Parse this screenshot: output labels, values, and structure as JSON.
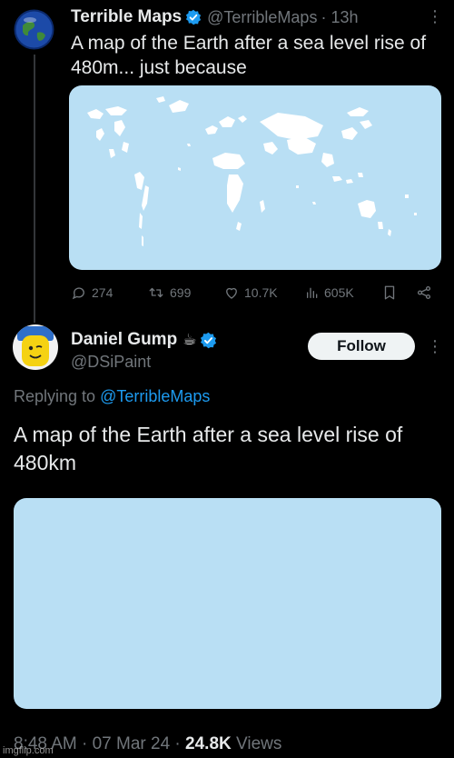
{
  "tweet1": {
    "display_name": "Terrible Maps",
    "handle": "@TerribleMaps",
    "time": "· 13h",
    "more": "⋮",
    "text": "A map of the Earth after a sea level rise of 480m... just because",
    "stats": {
      "replies": "274",
      "retweets": "699",
      "likes": "10.7K",
      "views": "605K"
    }
  },
  "tweet2": {
    "display_name": "Daniel Gump",
    "name_emoji": "☕",
    "handle": "@DSiPaint",
    "follow_label": "Follow",
    "more": "⋮",
    "replying_prefix": "Replying to",
    "replying_handle": "@TerribleMaps",
    "text": "A map of the Earth after a sea level rise of 480km",
    "meta_time": "8:48 AM · 07 Mar 24 ·",
    "meta_views_count": "24.8K",
    "meta_views_label": "Views"
  },
  "watermark": "imgflip.com",
  "colors": {
    "accent": "#1d9bf0",
    "ocean": "#b9dff4",
    "muted": "#71767b"
  }
}
